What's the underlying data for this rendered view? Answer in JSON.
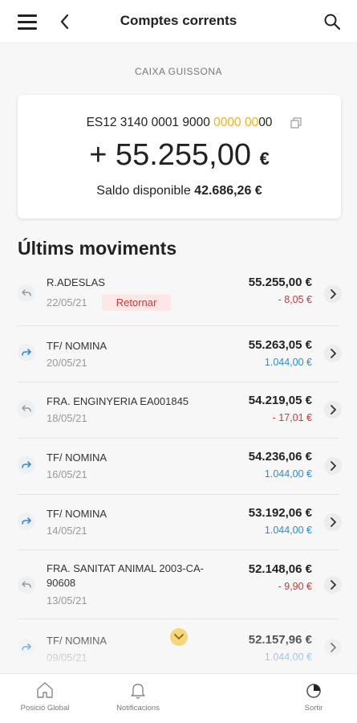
{
  "header": {
    "title": "Comptes corrents"
  },
  "account": {
    "bank": "CAIXA GUISSONA",
    "iban_prefix": "ES12 3140 0001 9000 ",
    "iban_highlight": "0000 00",
    "iban_suffix": "00",
    "balance": "+ 55.255,00",
    "currency": "€",
    "available_label": "Saldo disponible",
    "available_value": "42.686,26 €"
  },
  "movements_title": "Últims moviments",
  "movements": [
    {
      "description": "R.ADESLAS",
      "date": "22/05/21",
      "badge": "Retornar",
      "balance": "55.255,00 €",
      "amount": "- 8,05 €",
      "direction": "out"
    },
    {
      "description": "TF/ NOMINA",
      "date": "20/05/21",
      "balance": "55.263,05 €",
      "amount": "1.044,00 €",
      "direction": "in"
    },
    {
      "description": "FRA. ENGINYERIA EA001845",
      "date": "18/05/21",
      "balance": "54.219,05 €",
      "amount": "- 17,01 €",
      "direction": "out"
    },
    {
      "description": "TF/ NOMINA",
      "date": "16/05/21",
      "balance": "54.236,06 €",
      "amount": "1.044,00 €",
      "direction": "in"
    },
    {
      "description": "TF/ NOMINA",
      "date": "14/05/21",
      "balance": "53.192,06 €",
      "amount": "1.044,00 €",
      "direction": "in"
    },
    {
      "description": "FRA. SANITAT ANIMAL 2003-CA-90608",
      "date": "13/05/21",
      "balance": "52.148,06 €",
      "amount": "- 9,90 €",
      "direction": "out"
    },
    {
      "description": "TF/ NOMINA",
      "date": "09/05/21",
      "balance": "52.157,96 €",
      "amount": "1.044,00 €",
      "direction": "in"
    }
  ],
  "bottom_nav": [
    {
      "label": "Posició Global",
      "icon": "home-icon"
    },
    {
      "label": "Notificacions",
      "icon": "bell-icon"
    },
    {
      "label": "Sortir",
      "icon": "power-icon"
    }
  ],
  "colors": {
    "highlight": "#f0b319",
    "negative": "#c63b3b",
    "positive": "#2e8bd8",
    "badge_bg": "#fde7e7"
  }
}
